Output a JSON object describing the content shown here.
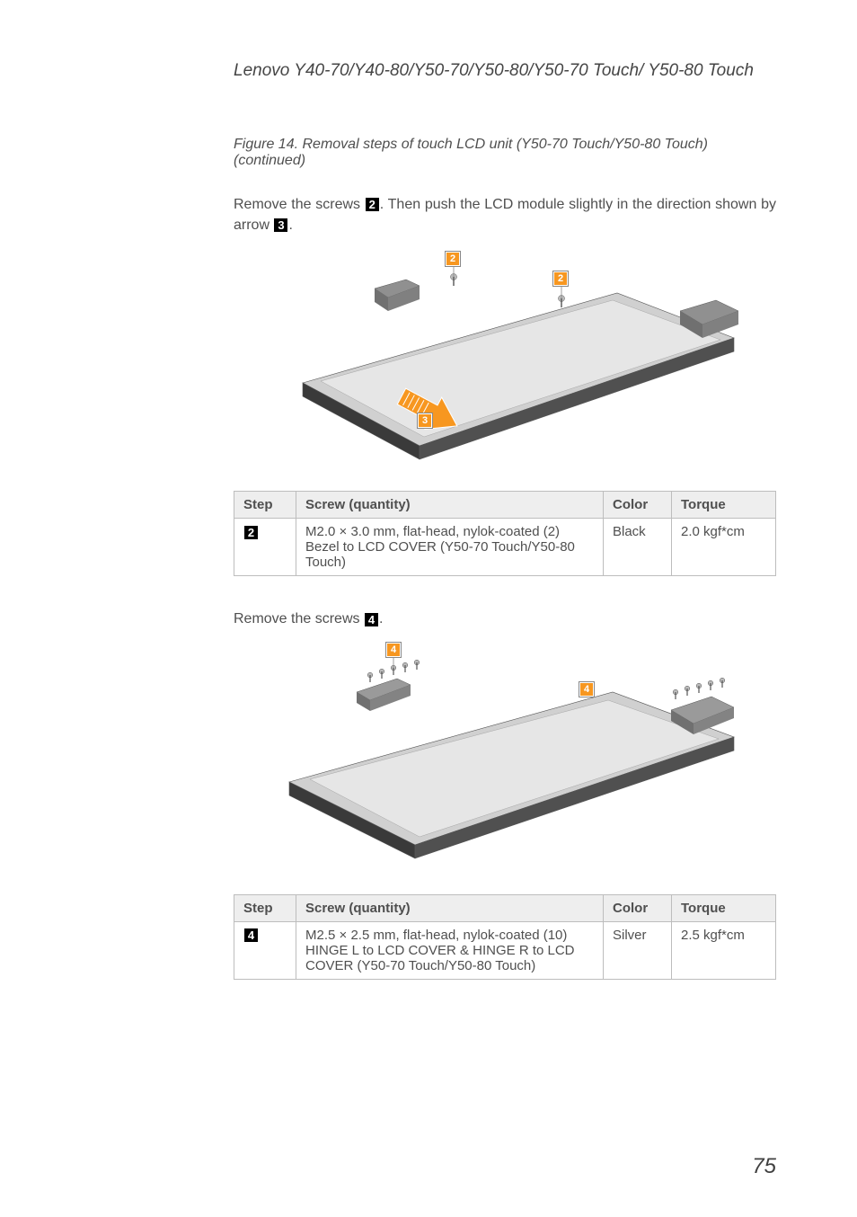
{
  "header": "Lenovo Y40-70/Y40-80/Y50-70/Y50-80/Y50-70 Touch/ Y50-80 Touch",
  "caption1": "Figure 14. Removal steps of touch LCD unit (Y50-70 Touch/Y50-80 Touch) (continued)",
  "para1_a": "Remove the screws ",
  "para1_b": ". Then push the LCD module slightly in the direction shown by arrow ",
  "para1_c": ".",
  "callout2": "2",
  "callout3": "3",
  "callout4": "4",
  "fig1": {
    "c1": "2",
    "c2": "2",
    "c3": "3"
  },
  "fig2": {
    "c1": "4",
    "c2": "4"
  },
  "table1": {
    "headers": {
      "step": "Step",
      "screw": "Screw (quantity)",
      "color": "Color",
      "torque": "Torque"
    },
    "row": {
      "step": "2",
      "screw": "M2.0 × 3.0 mm, flat-head, nylok-coated (2)\nBezel to LCD COVER (Y50-70 Touch/Y50-80 Touch)",
      "color": "Black",
      "torque": "2.0 kgf*cm"
    }
  },
  "para2_a": "Remove the screws ",
  "para2_b": ".",
  "table2": {
    "headers": {
      "step": "Step",
      "screw": "Screw (quantity)",
      "color": "Color",
      "torque": "Torque"
    },
    "row": {
      "step": "4",
      "screw": "M2.5 × 2.5 mm, flat-head, nylok-coated (10)\nHINGE L to LCD COVER & HINGE R to LCD COVER (Y50-70 Touch/Y50-80 Touch)",
      "color": "Silver",
      "torque": "2.5 kgf*cm"
    }
  },
  "page_num": "75"
}
